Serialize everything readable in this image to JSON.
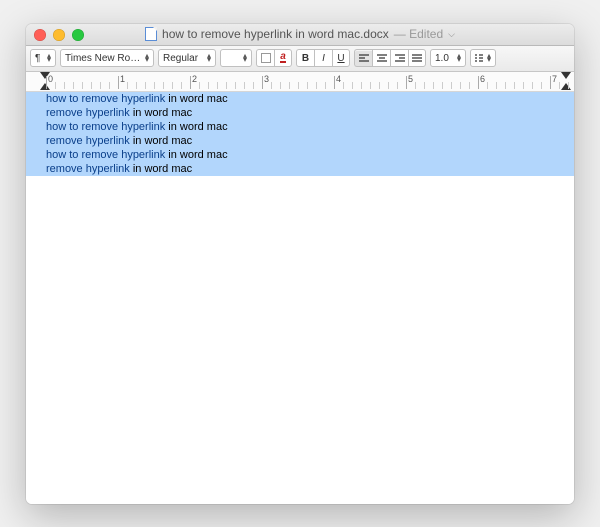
{
  "window": {
    "filename": "how to remove hyperlink in word mac.docx",
    "status": "— Edited"
  },
  "toolbar": {
    "style_label": "¶",
    "font": "Times New Rom…",
    "weight": "Regular",
    "size": "",
    "color_fill": "#ffffff",
    "color_text": "#c02020",
    "bold": "B",
    "italic": "I",
    "underline": "U",
    "spacing": "1.0",
    "list": "≔"
  },
  "ruler": {
    "marks": [
      0,
      1,
      2,
      3,
      4,
      5,
      6,
      7
    ]
  },
  "document": {
    "lines": [
      {
        "link": "how to remove hyperlink",
        "plain": " in word mac"
      },
      {
        "link": "remove hyperlink",
        "plain": " in word mac"
      },
      {
        "link": "how to remove hyperlink",
        "plain": " in word mac"
      },
      {
        "link": "remove hyperlink",
        "plain": " in word mac"
      },
      {
        "link": "how to remove hyperlink",
        "plain": " in word mac"
      },
      {
        "link": "remove hyperlink",
        "plain": " in word mac"
      }
    ]
  }
}
